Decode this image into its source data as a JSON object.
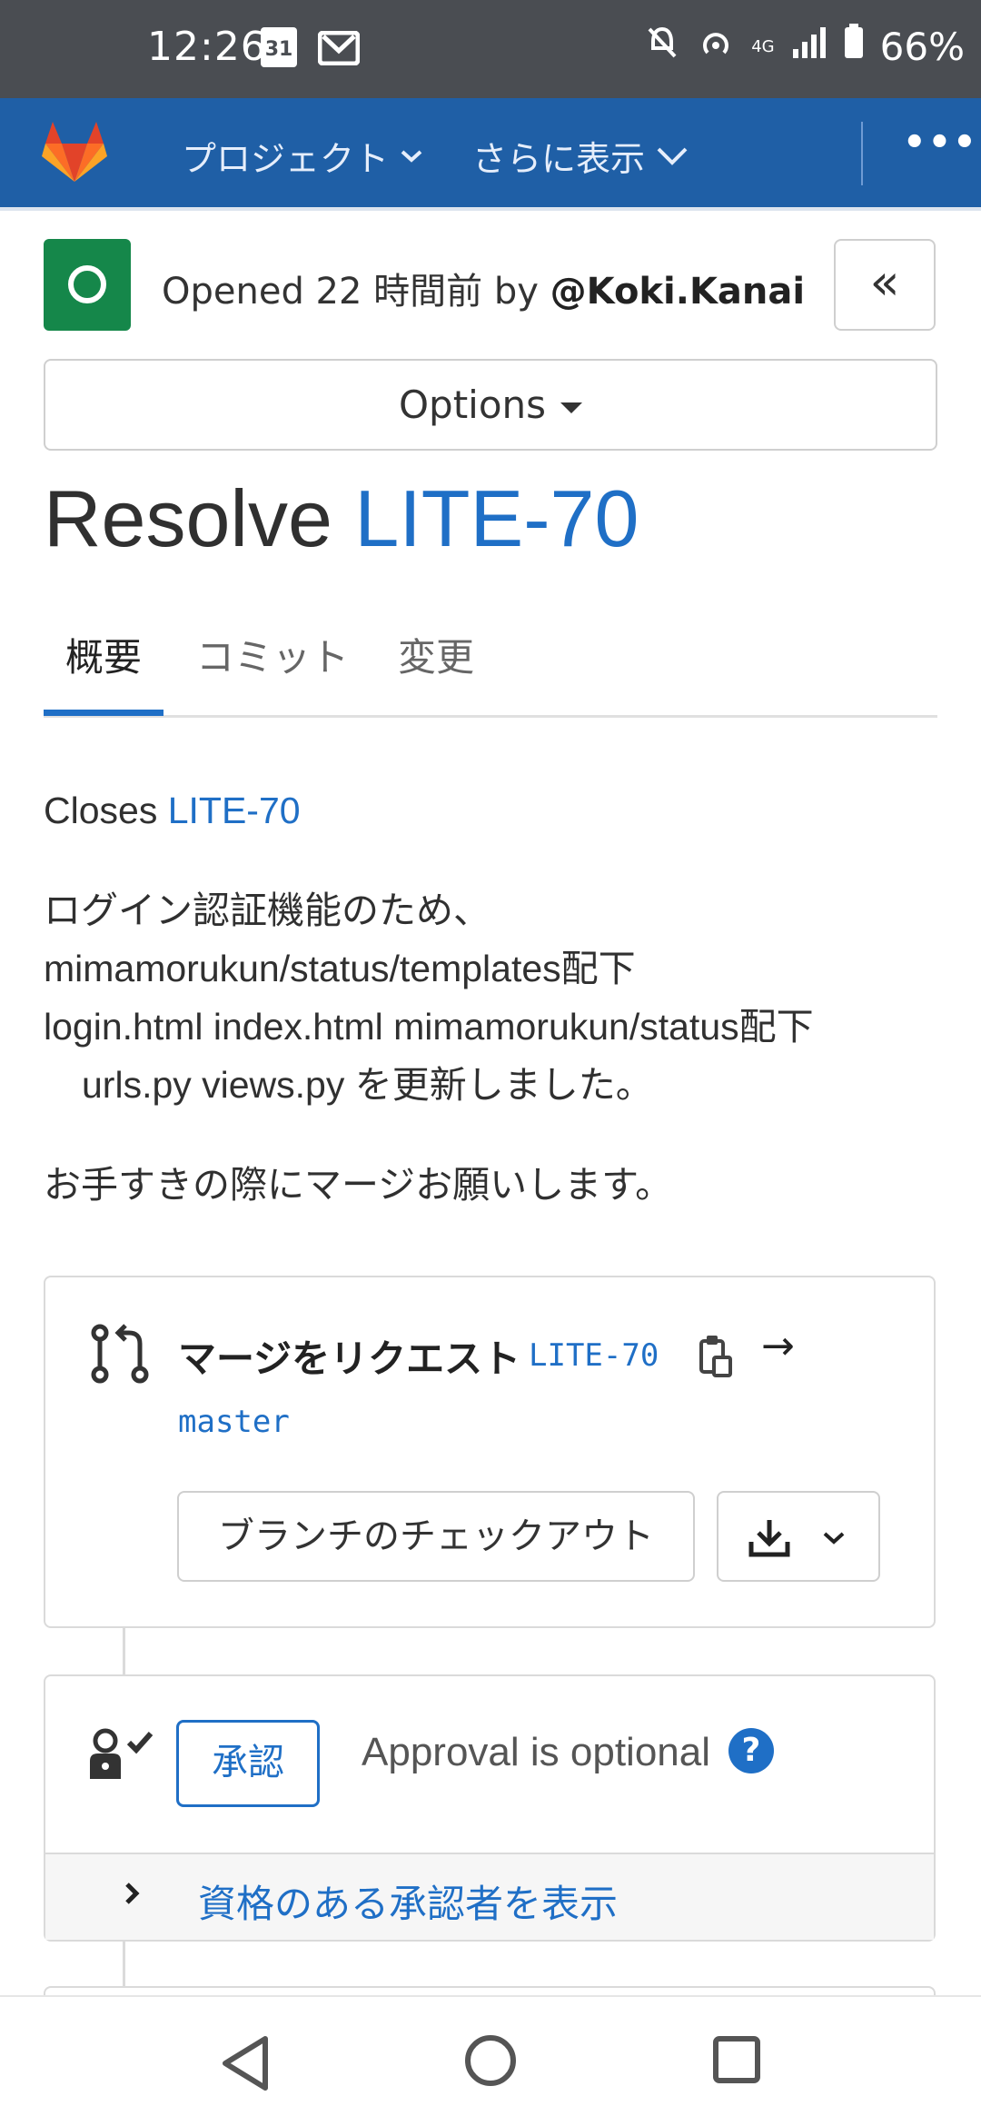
{
  "status_bar": {
    "time": "12:26",
    "calendar_day": "31",
    "network": "4G",
    "battery": "66%"
  },
  "nav": {
    "project_menu": "プロジェクト",
    "more_menu": "さらに表示",
    "overflow": "•••"
  },
  "header": {
    "opened_text": "Opened 22 時間前 by ",
    "author": "@Koki.Kanai",
    "collapse_label": "«"
  },
  "options": {
    "label": "Options"
  },
  "title": {
    "prefix": "Resolve ",
    "issue": "LITE-70"
  },
  "tabs": [
    {
      "label": "概要",
      "active": true
    },
    {
      "label": "コミット",
      "active": false
    },
    {
      "label": "変更",
      "active": false
    }
  ],
  "description": {
    "closes_prefix": "Closes ",
    "closes_issue": "LITE-70",
    "lines": [
      "ログイン認証機能のため、",
      "mimamorukun/status/templates配下",
      "login.html index.html mimamorukun/status配下",
      "urls.py views.py を更新しました。"
    ],
    "closing": "お手すきの際にマージお願いします。"
  },
  "merge_request": {
    "heading": "マージをリクエスト",
    "source_branch": "LITE-70",
    "arrow": "→",
    "target_branch": "master",
    "checkout_label": "ブランチのチェックアウト"
  },
  "approval": {
    "button_label": "承認",
    "text": "Approval is optional",
    "help": "?",
    "show_approvers": "資格のある承認者を表示"
  },
  "colors": {
    "nav_bg": "#1f5fa6",
    "link": "#1f6fc6",
    "status_open": "#15874a",
    "statusbar_bg": "#4a4d52"
  }
}
